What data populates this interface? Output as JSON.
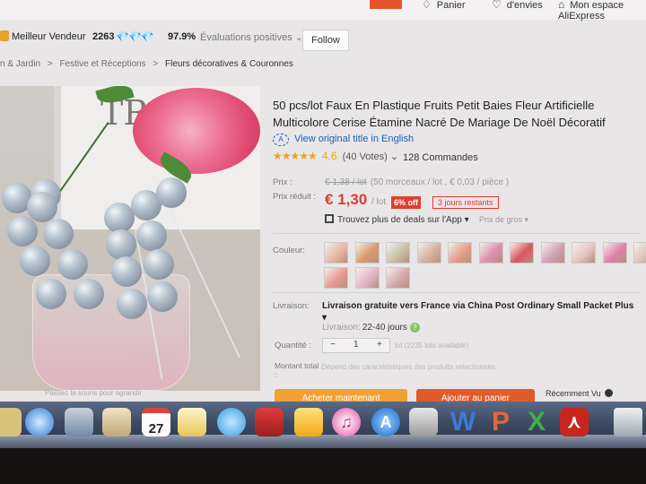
{
  "header": {
    "cart_label": "Panier",
    "wishlist_label": "d'envies",
    "account_label": "Mon espace AliExpress"
  },
  "seller": {
    "badge_label": "Meilleur Vendeur",
    "score": "2263",
    "diamonds": "💎💎💎",
    "positive_rate": "97.9%",
    "feedback_label": "Évaluations positives",
    "follow_label": "Follow"
  },
  "breadcrumb": {
    "items": [
      "n & Jardin",
      "Festive et Réceptions",
      "Fleurs décoratives & Couronnes"
    ],
    "separator": ">"
  },
  "photo": {
    "frame_text": "TR",
    "footer_text": "Passez la souris pour agrandir"
  },
  "product": {
    "title": "50 pcs/lot Faux En Plastique Fruits Petit Baies Fleur Artificielle Multicolore Cerise Étamine Nacré De Mariage De Noël Décoratif",
    "view_original": "View original title in English",
    "stars": "★★★★★",
    "rating": "4.6",
    "votes": "(40 Votes)",
    "orders": "128 Commandes"
  },
  "price": {
    "price_label": "Prix :",
    "old_price": "€ 1,38 / lot",
    "old_detail": "(50 morceaux / lot , € 0,03 / pièce )",
    "discount_label": "Prix réduit :",
    "new_price": "€ 1,30",
    "per_lot": "/ lot",
    "off_badge": "6% off",
    "left_badge": "3 jours restants",
    "app_deals": "Trouvez plus de deals sur l'App",
    "wholesale": "Prix de gros"
  },
  "color": {
    "label": "Couleur:",
    "swatch_colors": [
      "#e7b9a8",
      "#d99a6b",
      "#c7c2a8",
      "#d8b3a1",
      "#e4a08c",
      "#dd8fb0",
      "#d9565e",
      "#cfa2b5",
      "#e5c5c2",
      "#e07fa8",
      "#dcc3be",
      "#e69b92",
      "#e4b5c8",
      "#d6a9ac"
    ]
  },
  "shipping": {
    "label": "Livraison:",
    "method": "Livraison gratuite vers France via China Post Ordinary Small Packet Plus",
    "delivery_label": "Livraison:",
    "delivery_days": "22-40 jours",
    "help_icon": "?"
  },
  "quantity": {
    "label": "Quantité :",
    "minus": "−",
    "value": "1",
    "plus": "+",
    "available": "lot (2235 lots available)"
  },
  "total": {
    "label": "Montant total :",
    "note": "Dépend des caractéristiques des produits sélectionnés"
  },
  "actions": {
    "buy_label": "Acheter maintenant",
    "cart_label": "Ajouter au panier",
    "recent_label": "Récemment Vu"
  },
  "dock": {
    "calendar_day": "27",
    "word_letter": "W",
    "ppt_letter": "P",
    "excel_letter": "X"
  }
}
